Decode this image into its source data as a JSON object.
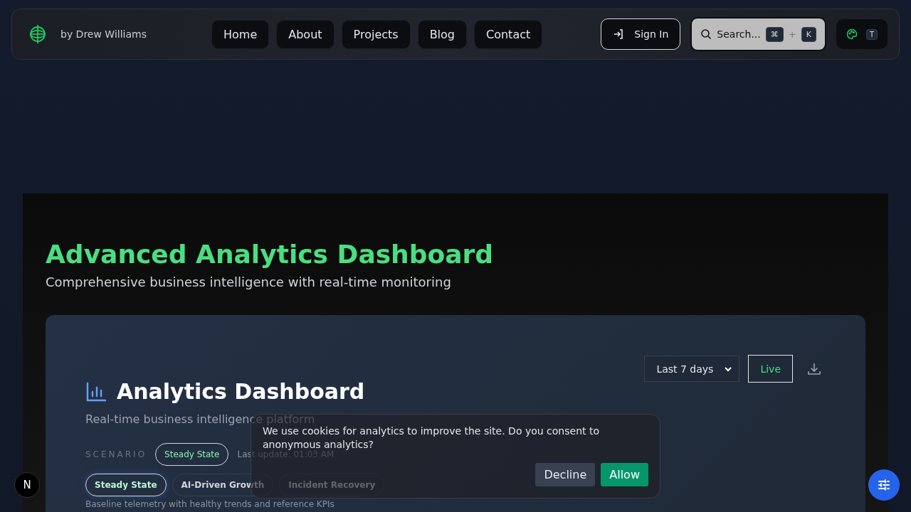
{
  "header": {
    "byline": "by Drew Williams",
    "nav": [
      {
        "label": "Home"
      },
      {
        "label": "About"
      },
      {
        "label": "Projects"
      },
      {
        "label": "Blog"
      },
      {
        "label": "Contact"
      }
    ],
    "sign_in": "Sign In",
    "search": {
      "placeholder": "Search...",
      "keys": [
        "⌘",
        "K"
      ],
      "joiner": "+"
    },
    "theme_key": "T"
  },
  "hero": {
    "title": "Advanced Analytics Dashboard",
    "subtitle": "Comprehensive business intelligence with real-time monitoring"
  },
  "dashboard": {
    "title": "Analytics Dashboard",
    "subtitle": "Real-time business intelligence platform",
    "range": "Last 7 days",
    "live": "Live",
    "scenario_label": "SCENARIO",
    "scenario_badge": "Steady State",
    "last_update": "Last update: 01:03 AM",
    "scenarios": [
      {
        "label": "Steady State",
        "selected": true
      },
      {
        "label": "AI-Driven Growth",
        "selected": false
      },
      {
        "label": "Incident Recovery",
        "selected": false
      }
    ],
    "description": "Baseline telemetry with healthy trends and reference KPIs"
  },
  "cookie_banner": {
    "text": "We use cookies for analytics to improve the site. Do you consent to anonymous analytics?",
    "buttons": [
      "Decline",
      "Allow"
    ]
  },
  "dev_badge": "N"
}
